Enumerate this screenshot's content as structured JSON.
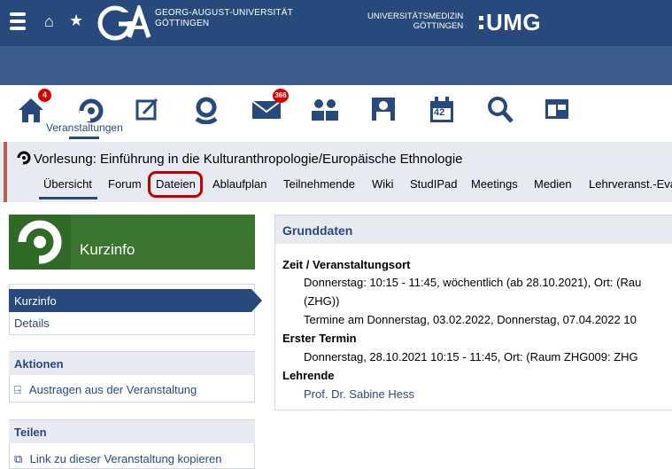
{
  "header": {
    "university": [
      "GEORG-AUGUST-UNIVERSITÄT",
      "GÖTTINGEN"
    ],
    "umg_subtitle": [
      "UNIVERSITÄTSMEDIZIN",
      "GÖTTINGEN"
    ],
    "umg_mark": "UMG"
  },
  "nav": {
    "home_badge": "4",
    "messages_badge": "366",
    "calendar_day": "42",
    "active_label": "Veranstaltungen"
  },
  "course": {
    "title": "Vorlesung: Einführung in die Kulturanthropologie/Europäische Ethnologie",
    "tabs": [
      "Übersicht",
      "Forum",
      "Dateien",
      "Ablaufplan",
      "Teilnehmende",
      "Wiki",
      "StudIPad",
      "Meetings",
      "Medien",
      "Lehrveranst.-Eva"
    ]
  },
  "sidebar": {
    "heading": "Kurzinfo",
    "items": [
      "Kurzinfo",
      "Details"
    ],
    "actions_title": "Aktionen",
    "actions": [
      "Austragen aus der Veranstaltung"
    ],
    "share_title": "Teilen",
    "share": [
      "Link zu dieser Veranstaltung kopieren"
    ]
  },
  "panel": {
    "title": "Grunddaten",
    "label_time": "Zeit / Veranstaltungsort",
    "time_lines": [
      "Donnerstag: 10:15 - 11:45, wöchentlich (ab 28.10.2021), Ort: (Rau",
      "(ZHG))",
      "Termine am Donnerstag, 03.02.2022, Donnerstag, 07.04.2022 10"
    ],
    "label_first": "Erster Termin",
    "first_line": "Donnerstag, 28.10.2021 10:15 - 11:45, Ort: (Raum ZHG009: ZHG",
    "label_teachers": "Lehrende",
    "teacher": "Prof. Dr. Sabine Hess"
  }
}
